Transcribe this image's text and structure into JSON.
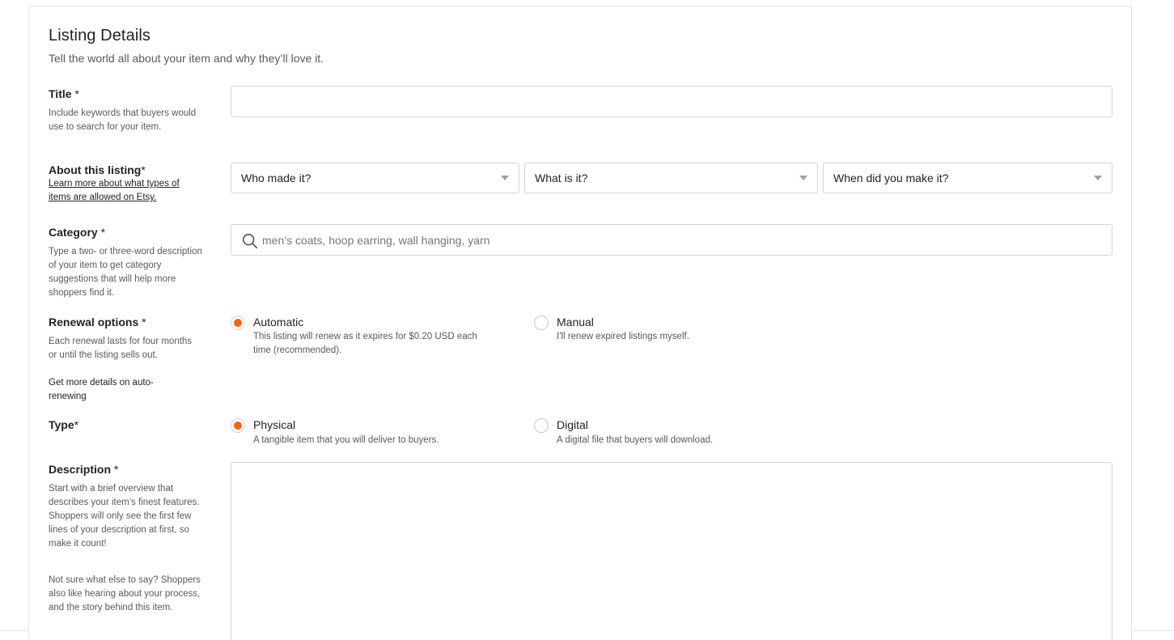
{
  "section": {
    "title": "Listing Details",
    "subtitle": "Tell the world all about your item and why they’ll love it."
  },
  "title_field": {
    "label": "Title",
    "required_mark": " *",
    "help": "Include keywords that buyers would use to search for your item.",
    "value": ""
  },
  "about": {
    "label": "About this listing",
    "required_mark": "*",
    "help_link": "Learn more about what types of items are allowed on Etsy.",
    "selects": [
      {
        "selected": "Who made it?"
      },
      {
        "selected": "What is it?"
      },
      {
        "selected": "When did you make it?"
      }
    ]
  },
  "category": {
    "label": "Category",
    "required_mark": " *",
    "help": "Type a two- or three-word description of your item to get category suggestions that will help more shoppers find it.",
    "placeholder": "men’s coats, hoop earring, wall hanging, yarn",
    "icon": "search-icon"
  },
  "renewal": {
    "label": "Renewal options",
    "required_mark": " *",
    "help": "Each renewal lasts for four months or until the listing sells out.",
    "help_link": "Get more details on auto-renewing",
    "options": [
      {
        "label": "Automatic",
        "description": "This listing will renew as it expires for $0.20 USD each time (recommended).",
        "checked": true
      },
      {
        "label": "Manual",
        "description": "I'll renew expired listings myself.",
        "checked": false
      }
    ]
  },
  "type": {
    "label": "Type",
    "required_mark": "*",
    "options": [
      {
        "label": "Physical",
        "description": "A tangible item that you will deliver to buyers.",
        "checked": true
      },
      {
        "label": "Digital",
        "description": "A digital file that buyers will download.",
        "checked": false
      }
    ]
  },
  "description": {
    "label": "Description",
    "required_mark": " *",
    "help_1": "Start with a brief overview that describes your item’s finest features. Shoppers will only see the first few lines of your description at first, so make it count!",
    "help_2": "Not sure what else to say? Shoppers also like hearing about your process, and the story behind this item.",
    "value": ""
  },
  "colors": {
    "accent": "#f1641e",
    "border": "#d5d5d5",
    "muted_text": "#595959"
  }
}
